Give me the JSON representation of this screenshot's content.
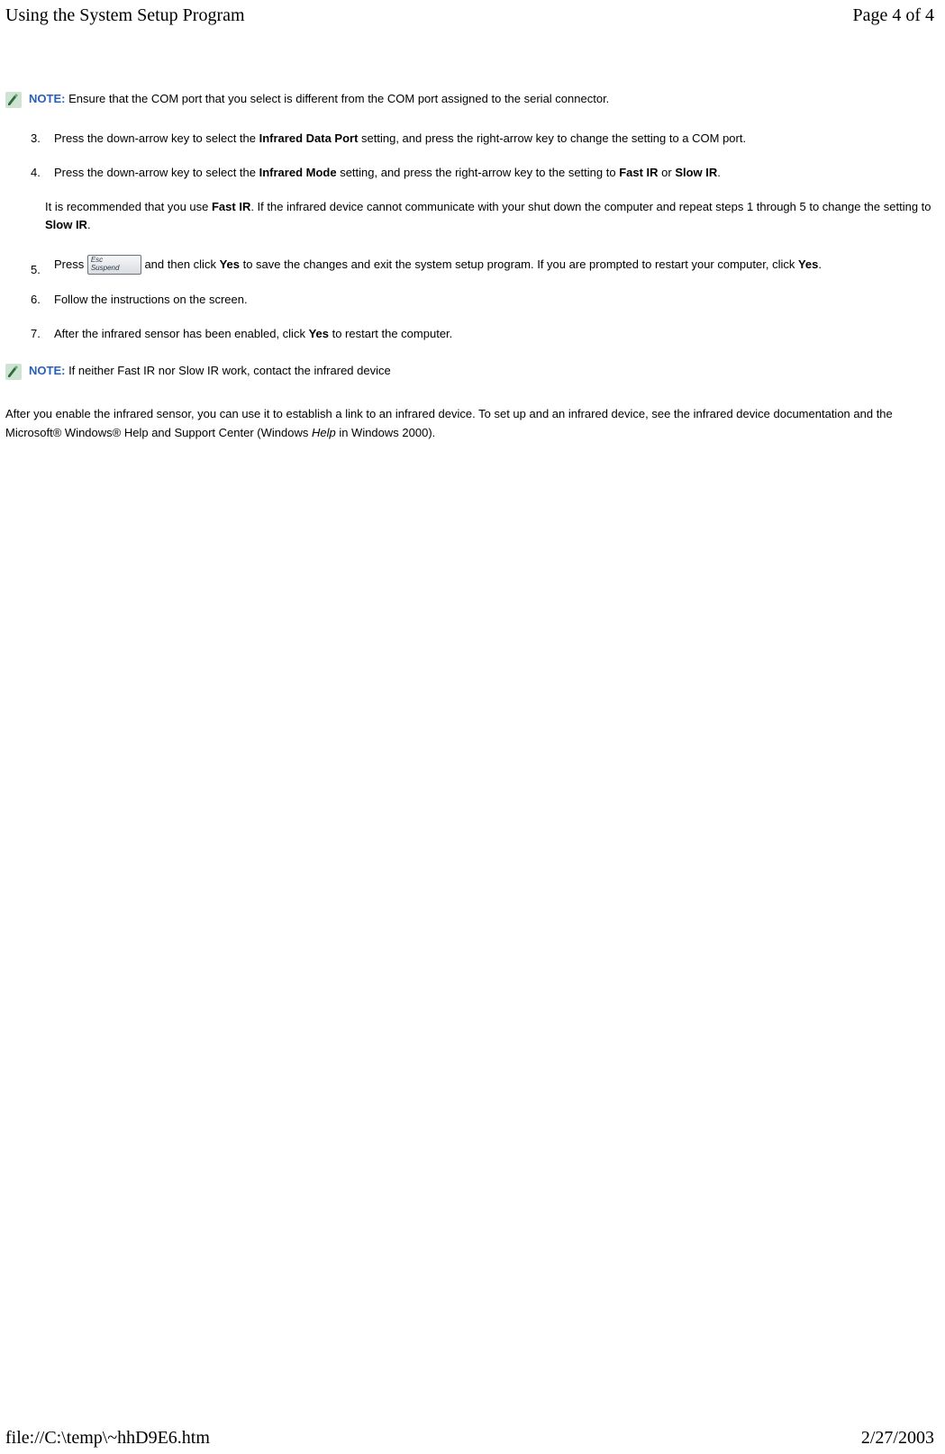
{
  "header": {
    "title": "Using the System Setup Program",
    "page": "Page 4 of 4"
  },
  "footer": {
    "path": "file://C:\\temp\\~hhD9E6.htm",
    "date": "2/27/2003"
  },
  "note1": {
    "label": "NOTE:",
    "text": " Ensure that the COM port that you select is different from the COM port assigned to the serial connector."
  },
  "steps": {
    "s3": {
      "num": "3.",
      "pre": "Press the down-arrow key to select the ",
      "b1": "Infrared Data Port",
      "post": " setting, and press the right-arrow key to change the setting to a COM port."
    },
    "s4": {
      "num": "4.",
      "pre": "Press the down-arrow key to select the ",
      "b1": "Infrared Mode",
      "mid": " setting, and press the right-arrow key to the setting to ",
      "b2": "Fast IR",
      "or": " or ",
      "b3": "Slow IR",
      "end": "."
    },
    "sub": {
      "pre": "It is recommended that you use ",
      "b1": "Fast IR",
      "mid": ". If the infrared device cannot communicate with your shut down the computer and repeat steps 1 through 5 to change the setting to ",
      "b2": "Slow IR",
      "end": "."
    },
    "s5": {
      "num": "5.",
      "pre": "Press ",
      "mid": " and then click ",
      "b1": "Yes",
      "mid2": " to save the changes and exit the system setup program. If you are prompted to restart your computer, click ",
      "b2": "Yes",
      "end": "."
    },
    "s6": {
      "num": "6.",
      "text": "Follow the instructions on the screen."
    },
    "s7": {
      "num": "7.",
      "pre": "After the infrared sensor has been enabled, click ",
      "b1": "Yes",
      "post": " to restart the computer."
    }
  },
  "note2": {
    "label": "NOTE:",
    "text": " If neither Fast IR nor Slow IR work, contact the infrared device"
  },
  "closing": {
    "p1a": "After you enable the infrared sensor, you can use it to establish a link to an infrared device. To set up and an infrared device, see the infrared device documentation and the Microsoft® Windows® Help and Support Center (Windows ",
    "p1i": "Help",
    "p1b": " in Windows 2000)."
  },
  "key": {
    "line1": "Esc",
    "line2": "Suspend"
  }
}
